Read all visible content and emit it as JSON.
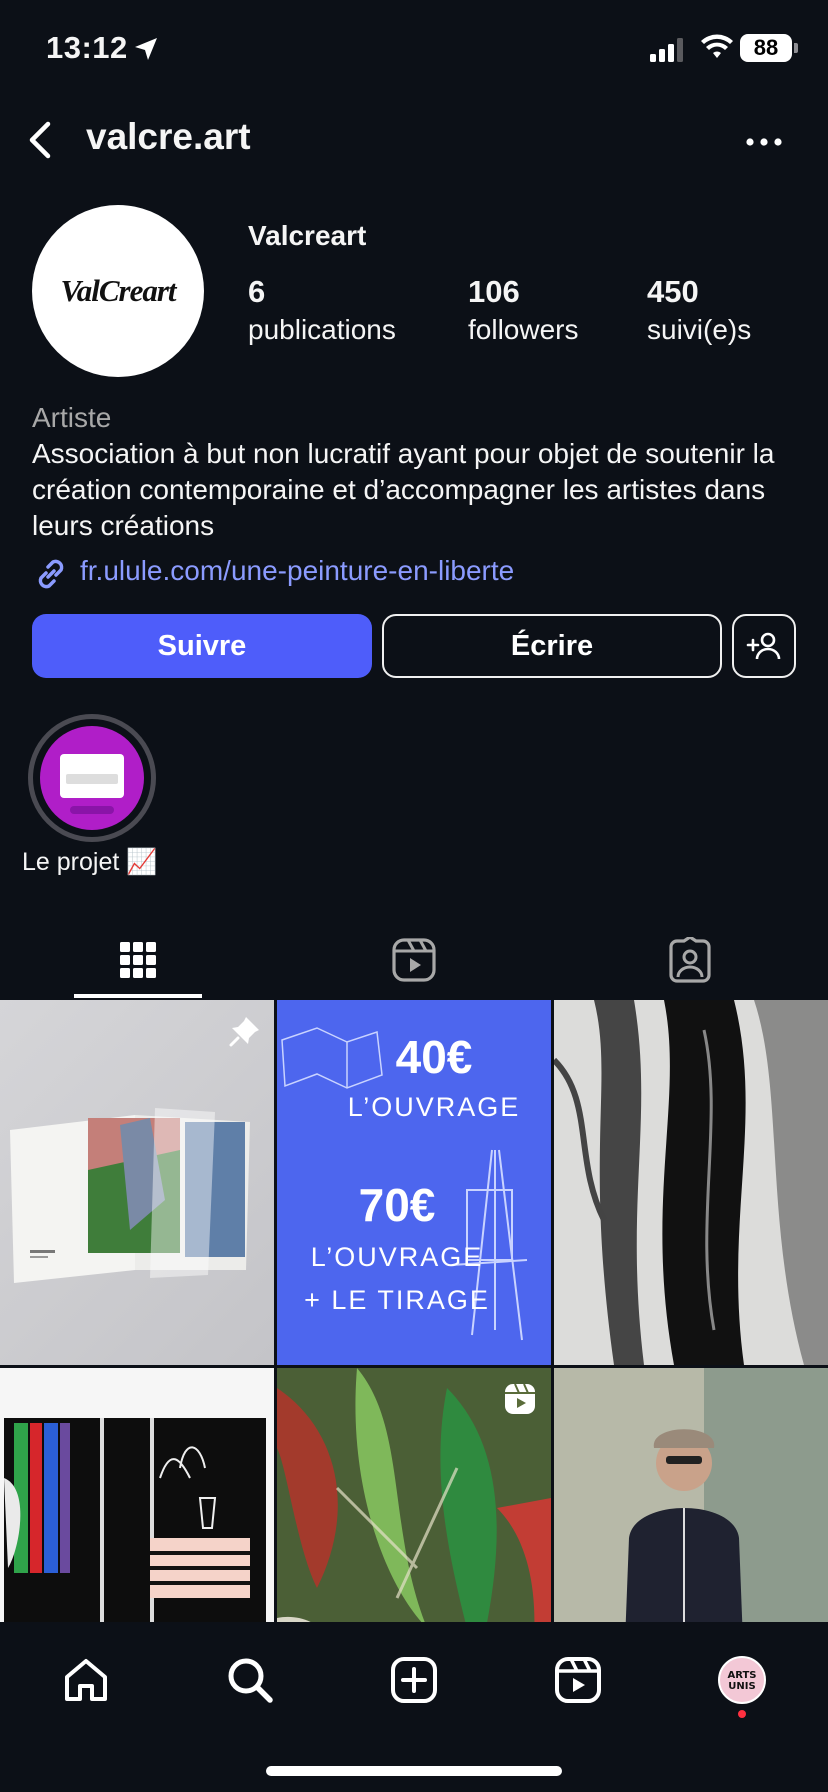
{
  "status_bar": {
    "time": "13:12",
    "battery": "88"
  },
  "header": {
    "username": "valcre.art"
  },
  "profile": {
    "avatar_text": "ValCreart",
    "display_name": "Valcreart",
    "stats": [
      {
        "value": "6",
        "label": "publications"
      },
      {
        "value": "106",
        "label": "followers"
      },
      {
        "value": "450",
        "label": "suivi(e)s"
      }
    ],
    "category": "Artiste",
    "bio": "Association à but non lucratif ayant pour objet de soutenir la création contemporaine et d’accompagner les artistes dans leurs créations",
    "link": "fr.ulule.com/une-peinture-en-liberte"
  },
  "actions": {
    "follow": "Suivre",
    "message": "Écrire"
  },
  "highlights": [
    {
      "label": "Le projet 📈"
    }
  ],
  "grid": {
    "post2": {
      "line1": "40€",
      "line2": "L’OUVRAGE",
      "line3": "70€",
      "line4": "L’OUVRAGE",
      "line5": "+ LE TIRAGE"
    }
  },
  "nav": {
    "profile_badge": "ARTS UNIS"
  },
  "colors": {
    "accent": "#4e5dfa",
    "link": "#8b9bff",
    "background": "#0c1017"
  }
}
